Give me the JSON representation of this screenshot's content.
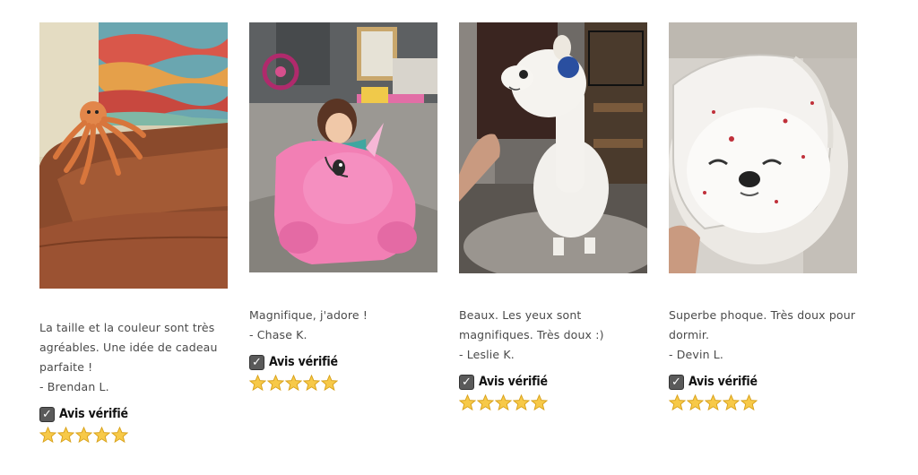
{
  "reviews": [
    {
      "image": "octopus-plush-photo",
      "text_lines": [
        "La taille et la couleur sont très",
        "agréables. Une idée de cadeau",
        "parfaite !"
      ],
      "author": "- Brendan L.",
      "verified_label": "Avis vérifié",
      "rating": 5
    },
    {
      "image": "pink-unicorn-plush-photo",
      "text_lines": [
        "Magnifique, j'adore !"
      ],
      "author": "- Chase K.",
      "verified_label": "Avis vérifié",
      "rating": 5
    },
    {
      "image": "alpaca-plush-photo",
      "text_lines": [
        "Beaux. Les yeux sont",
        "magnifiques. Très doux :)"
      ],
      "author": "- Leslie K.",
      "verified_label": "Avis vérifié",
      "rating": 5
    },
    {
      "image": "seal-plush-photo",
      "text_lines": [
        "Superbe phoque. Très doux pour",
        "dormir."
      ],
      "author": "- Devin L.",
      "verified_label": "Avis vérifié",
      "rating": 5
    }
  ],
  "icons": {
    "verified": "checkbox-checked-icon",
    "star": "star-icon"
  },
  "colors": {
    "star_fill": "#f7c948",
    "star_stroke": "#d9a21b",
    "check_bg": "#5a5a5a"
  }
}
